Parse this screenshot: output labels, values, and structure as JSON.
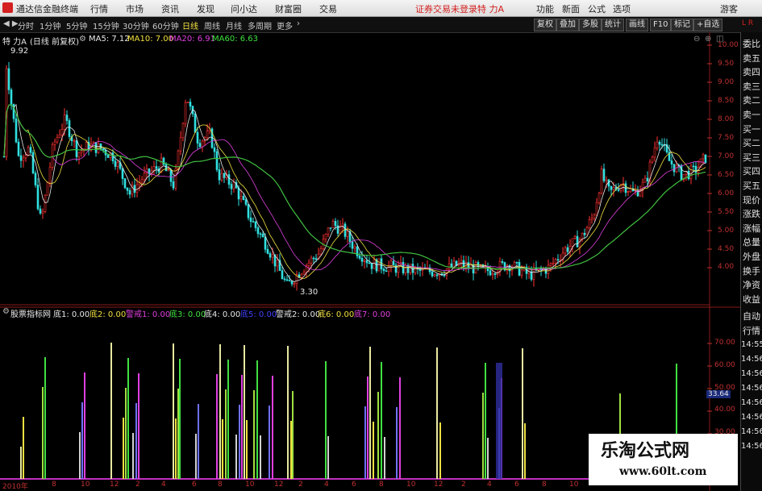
{
  "menubar": {
    "app_title": "通达信金融终端",
    "items": [
      "行情",
      "市场",
      "资讯",
      "发现",
      "问小达",
      "财富圈",
      "交易"
    ],
    "notice": "证券交易未登录",
    "stock_name": "特 力A",
    "right_items": [
      "功能",
      "新面",
      "公式",
      "选项"
    ],
    "guest": "游客"
  },
  "toolbar": {
    "periods": [
      "分时",
      "1分钟",
      "5分钟",
      "15分钟",
      "30分钟",
      "60分钟",
      "日线",
      "周线",
      "月线",
      "多周期",
      "更多"
    ],
    "active_period": "日线",
    "right_buttons": [
      "复权",
      "叠加",
      "多股",
      "统计",
      "画线",
      "F10",
      "标记",
      "+自选"
    ],
    "corner": "L R"
  },
  "main_chart": {
    "title": "特 力A",
    "adjust": "(日线 前复权)",
    "ma": [
      {
        "label": "MA5: 7.12",
        "color": "#e8e8e8"
      },
      {
        "label": "MA10: 7.00",
        "color": "#f0e040"
      },
      {
        "label": "MA20: 6.91",
        "color": "#e040e0"
      },
      {
        "label": "MA60: 6.63",
        "color": "#40e040"
      }
    ],
    "high_label": "9.92",
    "low_label": "3.30",
    "y_ticks": [
      "10.00",
      "9.50",
      "9.00",
      "8.50",
      "8.00",
      "7.50",
      "7.00",
      "6.50",
      "6.00",
      "5.50",
      "5.00",
      "4.50",
      "4.00"
    ]
  },
  "indicator": {
    "name": "股票指标网",
    "values": [
      {
        "label": "底1: 0.00",
        "color": "#e8e8e8"
      },
      {
        "label": "底2: 0.00",
        "color": "#f0e040"
      },
      {
        "label": "警戒1: 0.00",
        "color": "#e040e0"
      },
      {
        "label": "底3: 0.00",
        "color": "#40e040"
      },
      {
        "label": "底4: 0.00",
        "color": "#e8e8e8"
      },
      {
        "label": "底5: 0.00",
        "color": "#4040ff"
      },
      {
        "label": "警戒2: 0.00",
        "color": "#e8e8e8"
      },
      {
        "label": "底6: 0.00",
        "color": "#f0e040"
      },
      {
        "label": "底7: 0.00",
        "color": "#e040e0"
      }
    ],
    "y_ticks": [
      "70.00",
      "60.00",
      "50.00",
      "40.00",
      "30.00"
    ],
    "current_value": "33.64"
  },
  "x_axis": [
    "2010年",
    "8",
    "10",
    "12",
    "2",
    "4",
    "6",
    "8",
    "10",
    "12",
    "2",
    "4",
    "6",
    "8",
    "10",
    "12",
    "2",
    "4",
    "6",
    "8",
    "10"
  ],
  "side_panel": {
    "quote_labels": [
      "委比",
      "卖五",
      "卖四",
      "卖三",
      "卖二",
      "卖一",
      "买一",
      "买二",
      "买三",
      "买四",
      "买五",
      "现价",
      "涨跌",
      "涨幅",
      "总量",
      "外盘",
      "换手",
      "净资",
      "收益"
    ],
    "bottom_labels": [
      "自动",
      "行情"
    ],
    "times": [
      "14:55",
      "14:56",
      "14:56",
      "14:56",
      "14:56",
      "14:56",
      "14:56",
      "14:56"
    ]
  },
  "watermark": {
    "text": "乐淘公式网",
    "url": "www.60lt.com"
  }
}
